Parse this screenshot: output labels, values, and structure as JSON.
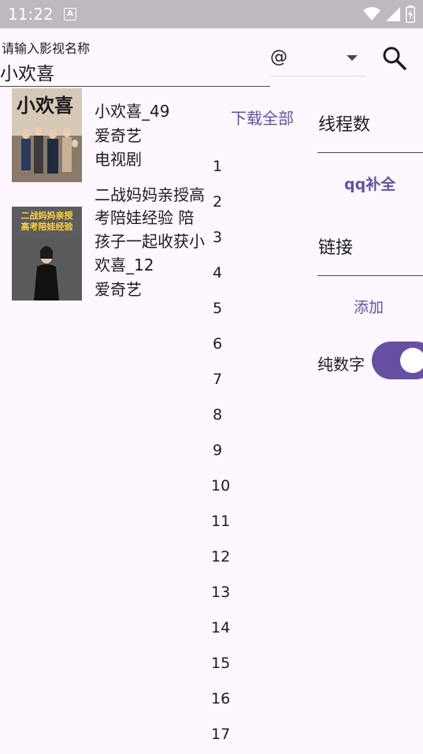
{
  "status_bar": {
    "time": "11:22",
    "notification_glyph": "A"
  },
  "search": {
    "hint": "请输入影视名称",
    "value": "小欢喜"
  },
  "at_dropdown": {
    "selected": "@"
  },
  "results": [
    {
      "poster_text": "小欢喜",
      "title": "小欢喜_49",
      "source": "爱奇艺",
      "category": "电视剧"
    },
    {
      "poster_text_1": "二战",
      "poster_text_2": "妈妈亲授",
      "poster_text_3": "高考陪娃经验",
      "title_lines": [
        "二战妈妈亲授高",
        "考陪娃经验 陪",
        "孩子一起收获小",
        "欢喜_12"
      ],
      "source": "爱奇艺"
    }
  ],
  "download_all_label": "下载全部",
  "episode_numbers": [
    "1",
    "2",
    "3",
    "4",
    "5",
    "6",
    "7",
    "8",
    "9",
    "10",
    "11",
    "12",
    "13",
    "14",
    "15",
    "16",
    "17"
  ],
  "thread_field": {
    "label": "线程数"
  },
  "qq_button": {
    "label": "qq补全"
  },
  "link_field": {
    "label": "链接"
  },
  "add_button": {
    "label": "添加"
  },
  "numeric_switch": {
    "label": "纯数字",
    "on": true
  },
  "colors": {
    "accent": "#6750A4",
    "background": "#FEF7FF",
    "status_bar": "#BDB9BE"
  }
}
